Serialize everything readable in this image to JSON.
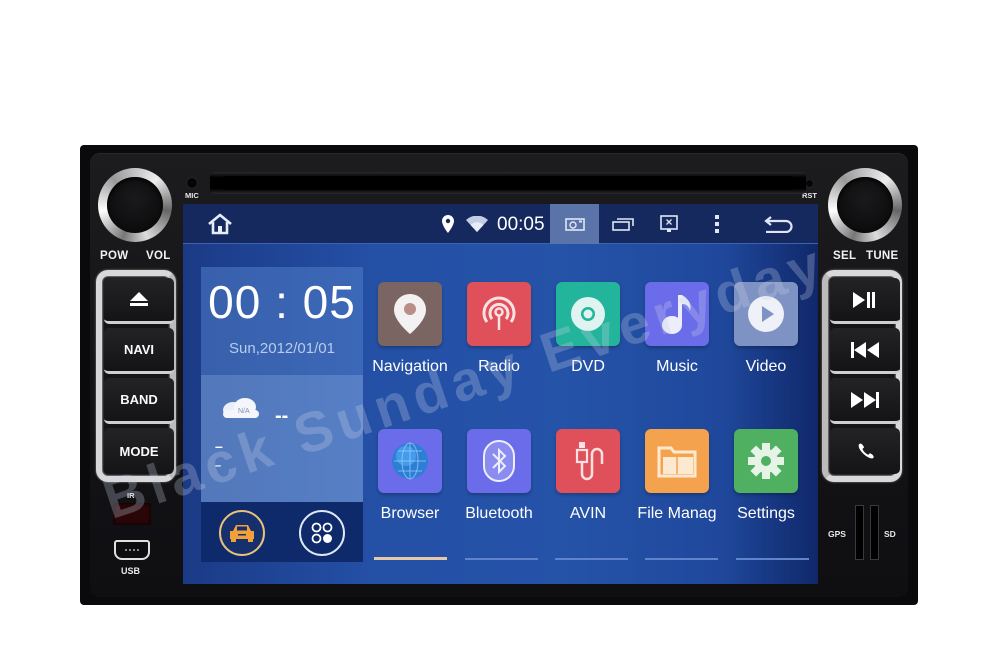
{
  "device": {
    "left_knob_labels": [
      "POW",
      "VOL"
    ],
    "right_knob_labels": [
      "SEL",
      "TUNE"
    ],
    "mic_label": "MIC",
    "rst_label": "RST",
    "ir_label": "IR",
    "usb_label": "USB",
    "gps_label": "GPS",
    "sd_label": "SD",
    "left_buttons": [
      {
        "name": "eject",
        "label": "",
        "icon": "eject-icon"
      },
      {
        "name": "navi",
        "label": "NAVI"
      },
      {
        "name": "band",
        "label": "BAND"
      },
      {
        "name": "mode",
        "label": "MODE"
      }
    ],
    "right_buttons": [
      {
        "name": "play-pause",
        "label": "",
        "icon": "play-pause-icon"
      },
      {
        "name": "previous",
        "label": "",
        "icon": "skip-previous-icon"
      },
      {
        "name": "next",
        "label": "",
        "icon": "skip-next-icon"
      },
      {
        "name": "phone",
        "label": "",
        "icon": "phone-icon"
      }
    ]
  },
  "status_bar": {
    "home_icon": "home-icon",
    "location_icon": "location-pin-icon",
    "wifi_icon": "wifi-icon",
    "time": "00:05",
    "screenshot_icon": "screenshot-icon",
    "recents_icon": "recent-apps-icon",
    "close_screen_icon": "close-screen-icon",
    "menu_icon": "more-vert-icon",
    "back_icon": "back-icon"
  },
  "widget": {
    "time": "00 : 05",
    "date": "Sun,2012/01/01",
    "weather": {
      "icon_text": "N/A",
      "temperature": "--",
      "line1": "–",
      "line2": "–"
    },
    "dock": [
      "car-icon",
      "apps-icon"
    ]
  },
  "apps": [
    {
      "label": "Navigation",
      "icon": "navigation-icon",
      "color": "#7a6563"
    },
    {
      "label": "Radio",
      "icon": "radio-icon",
      "color": "#e0505a"
    },
    {
      "label": "DVD",
      "icon": "dvd-icon",
      "color": "#23b49c"
    },
    {
      "label": "Music",
      "icon": "music-icon",
      "color": "#6b6cea"
    },
    {
      "label": "Video",
      "icon": "video-icon",
      "color": "#7f92c4"
    },
    {
      "label": "Browser",
      "icon": "browser-icon",
      "color": "#6b6cea"
    },
    {
      "label": "Bluetooth",
      "icon": "bluetooth-icon",
      "color": "#6b6cea"
    },
    {
      "label": "AVIN",
      "icon": "avin-icon",
      "color": "#e0505a"
    },
    {
      "label": "File Manag",
      "icon": "file-manager-icon",
      "color": "#f5a24f"
    },
    {
      "label": "Settings",
      "icon": "settings-icon",
      "color": "#4fb061"
    }
  ],
  "page_indicator": {
    "pages": 5,
    "active": 0
  },
  "watermark": "Black Sunday Everyday"
}
